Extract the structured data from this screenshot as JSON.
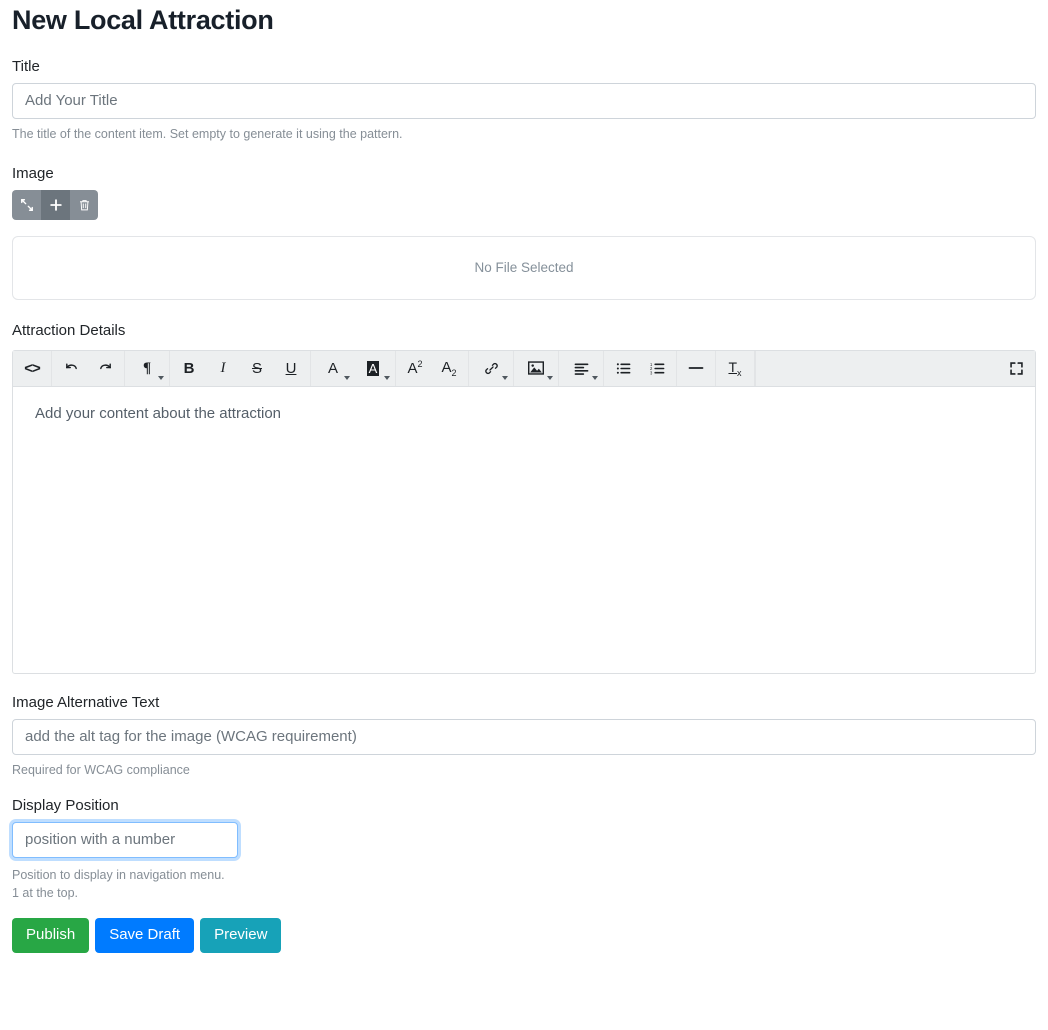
{
  "page": {
    "title": "New Local Attraction"
  },
  "title_field": {
    "label": "Title",
    "placeholder": "Add Your Title",
    "value": "",
    "help": "The title of the content item. Set empty to generate it using the pattern."
  },
  "image_field": {
    "label": "Image",
    "buttons": [
      {
        "name": "expand-collapse-icon",
        "title": "Expand"
      },
      {
        "name": "add-icon",
        "title": "Add"
      },
      {
        "name": "trash-icon",
        "title": "Remove"
      }
    ],
    "drop_text": "No File Selected"
  },
  "editor": {
    "label": "Attraction Details",
    "placeholder": "Add your content about the attraction",
    "content": "Add your content about the attraction",
    "toolbar": [
      {
        "group": 1,
        "items": [
          {
            "name": "source-code-icon",
            "glyph": "<>",
            "caret": false
          }
        ]
      },
      {
        "group": 2,
        "items": [
          {
            "name": "undo-icon",
            "glyph": "undo",
            "caret": false
          },
          {
            "name": "redo-icon",
            "glyph": "redo",
            "caret": false
          }
        ]
      },
      {
        "group": 3,
        "items": [
          {
            "name": "paragraph-format-icon",
            "glyph": "pilcrow",
            "caret": true
          }
        ]
      },
      {
        "group": 4,
        "items": [
          {
            "name": "bold-icon",
            "glyph": "B",
            "caret": false
          },
          {
            "name": "italic-icon",
            "glyph": "I",
            "caret": false
          },
          {
            "name": "strikethrough-icon",
            "glyph": "S",
            "caret": false
          },
          {
            "name": "underline-icon",
            "glyph": "U",
            "caret": false
          }
        ]
      },
      {
        "group": 5,
        "items": [
          {
            "name": "text-color-icon",
            "glyph": "A",
            "caret": true
          },
          {
            "name": "background-color-icon",
            "glyph": "A-highlight",
            "caret": true
          }
        ]
      },
      {
        "group": 6,
        "items": [
          {
            "name": "superscript-icon",
            "glyph": "A2sup",
            "caret": false
          },
          {
            "name": "subscript-icon",
            "glyph": "A2sub",
            "caret": false
          }
        ]
      },
      {
        "group": 7,
        "items": [
          {
            "name": "insert-link-icon",
            "glyph": "link",
            "caret": true
          }
        ]
      },
      {
        "group": 8,
        "items": [
          {
            "name": "insert-image-icon",
            "glyph": "image",
            "caret": true
          }
        ]
      },
      {
        "group": 9,
        "items": [
          {
            "name": "align-icon",
            "glyph": "align",
            "caret": true
          }
        ]
      },
      {
        "group": 10,
        "items": [
          {
            "name": "unordered-list-icon",
            "glyph": "ul",
            "caret": false
          },
          {
            "name": "ordered-list-icon",
            "glyph": "ol",
            "caret": false
          }
        ]
      },
      {
        "group": 11,
        "items": [
          {
            "name": "horizontal-rule-icon",
            "glyph": "hr",
            "caret": false
          }
        ]
      },
      {
        "group": 12,
        "items": [
          {
            "name": "clear-formatting-icon",
            "glyph": "Tx",
            "caret": false
          }
        ]
      },
      {
        "group": 13,
        "items": [
          {
            "name": "fullscreen-icon",
            "glyph": "fullscreen",
            "caret": false
          }
        ]
      }
    ]
  },
  "alt_text_field": {
    "label": "Image Alternative Text",
    "placeholder": "add the alt tag for the image (WCAG requirement)",
    "value": "",
    "help": "Required for WCAG compliance"
  },
  "position_field": {
    "label": "Display Position",
    "placeholder": "position with a number",
    "value": "",
    "help_line1": "Position to display in navigation menu.",
    "help_line2": "1 at the top."
  },
  "actions": {
    "publish": "Publish",
    "save_draft": "Save Draft",
    "preview": "Preview"
  },
  "colors": {
    "publish": "#28a745",
    "save_draft": "#007bff",
    "preview": "#17a2b8",
    "focus_border": "#80bdff",
    "button_gray": "#868e96",
    "button_gray_dark": "#6c757d"
  }
}
